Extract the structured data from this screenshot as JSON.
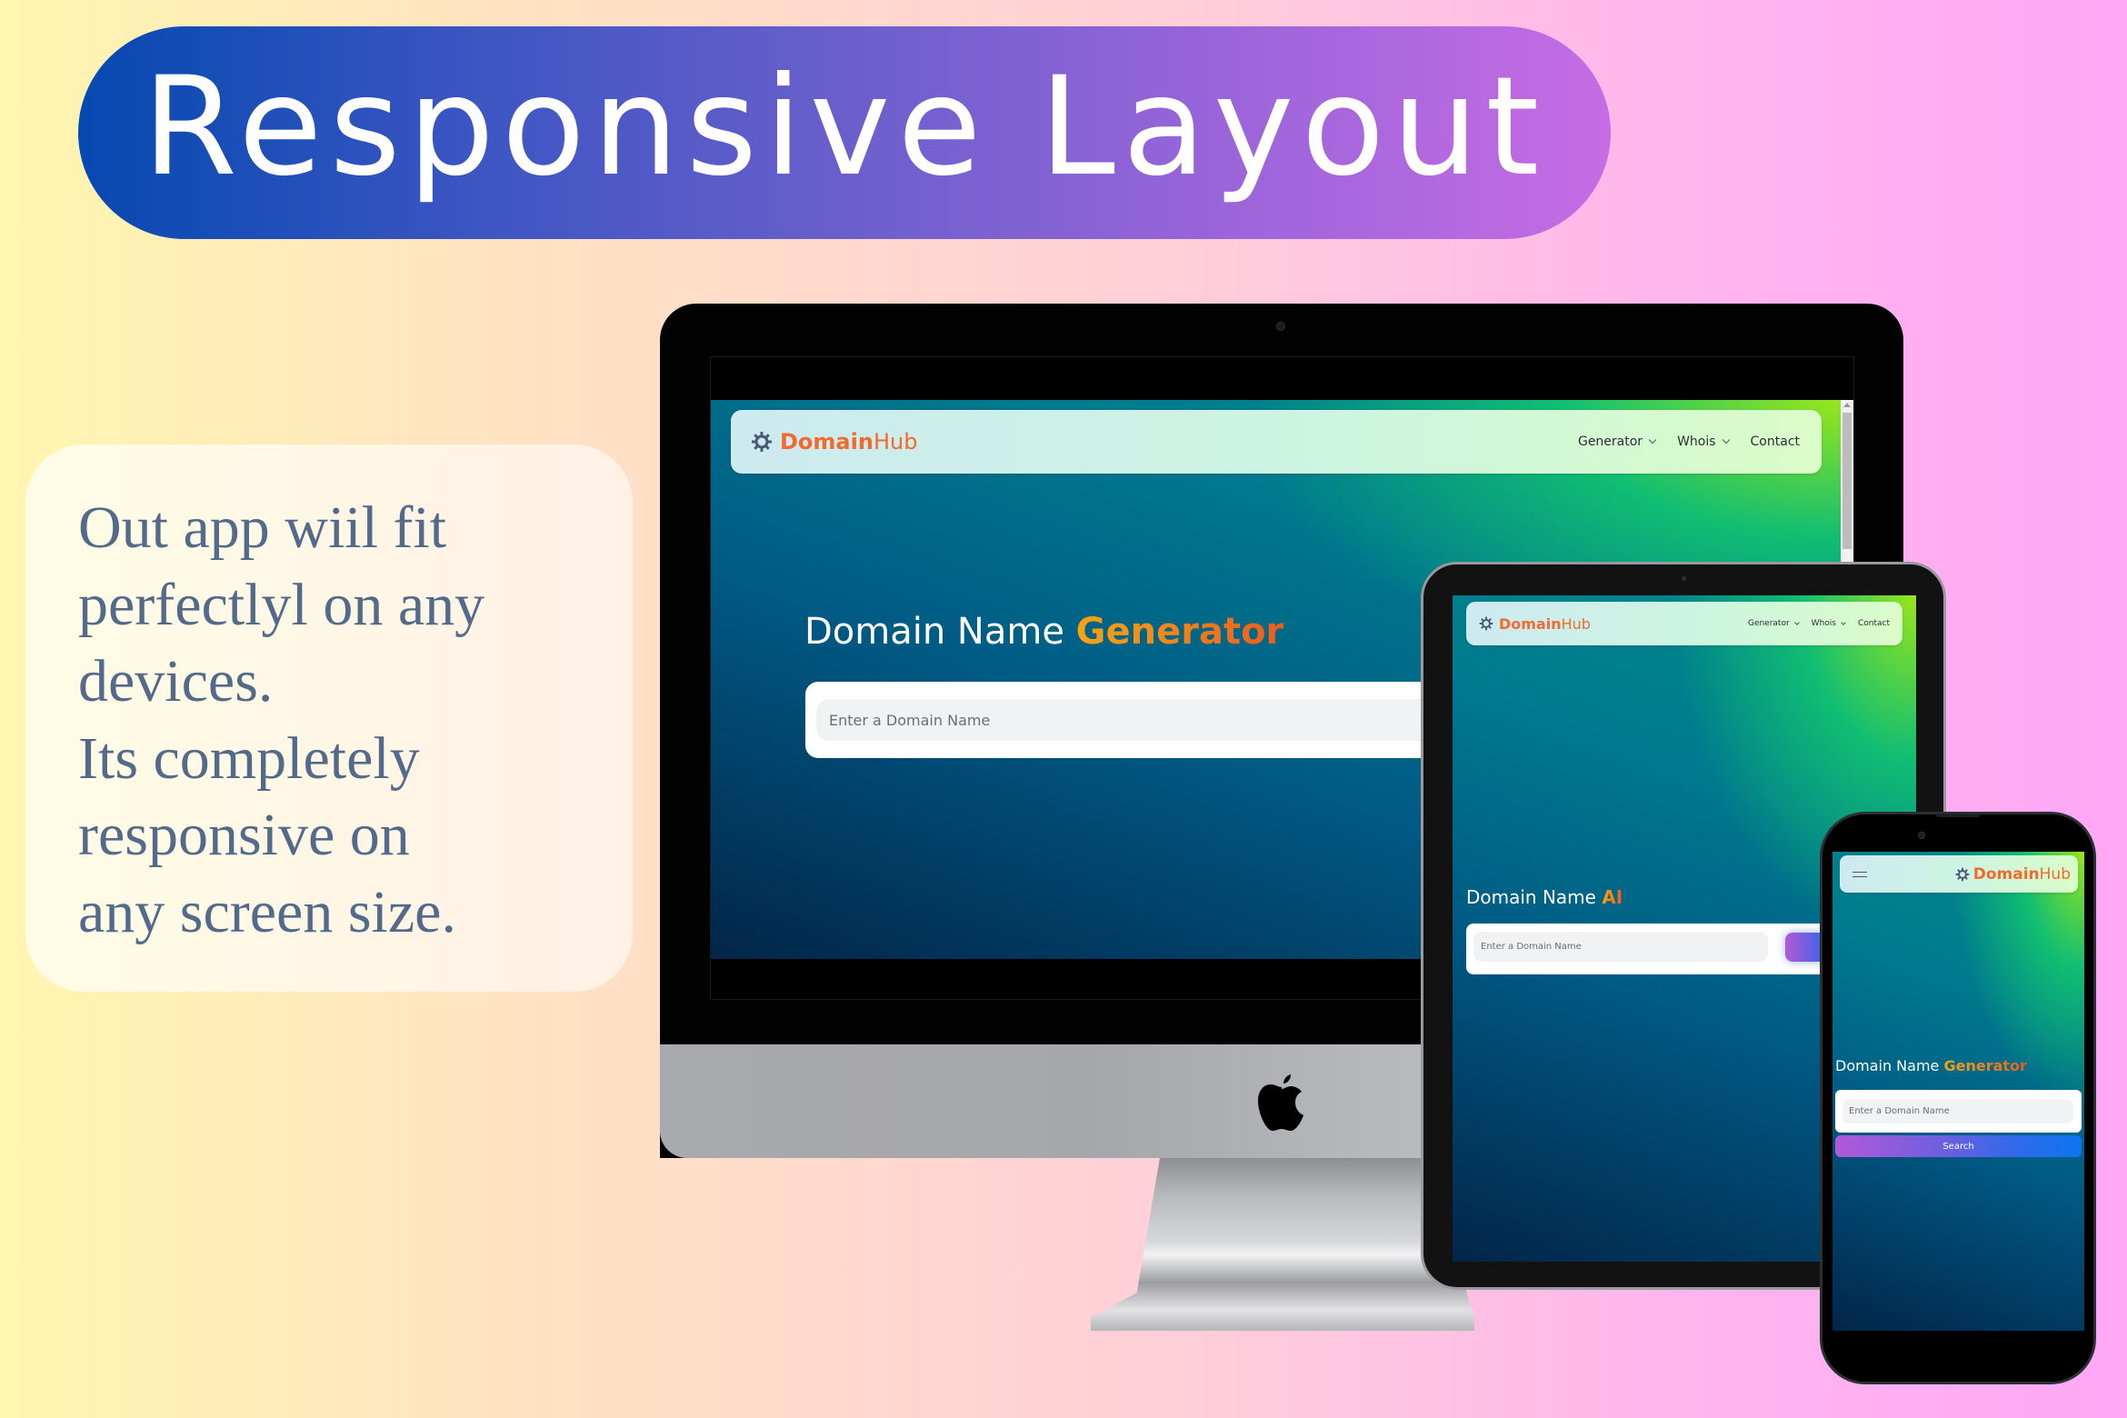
{
  "banner": {
    "title": "Responsive Layout"
  },
  "info_card": {
    "text": "Out app wiil fit\nperfectlyl on any\ndevices.\nIts completely\nresponsive on\nany screen size."
  },
  "brand": {
    "name_bold": "Domain",
    "name_regular": "Hub",
    "icon": "gear-icon",
    "color": "#f26a2e"
  },
  "nav": {
    "items": [
      {
        "label": "Generator",
        "has_dropdown": true
      },
      {
        "label": "Whois",
        "has_dropdown": true
      },
      {
        "label": "Contact",
        "has_dropdown": false
      }
    ]
  },
  "desktop": {
    "hero_prefix": "Domain Name ",
    "hero_accent": "Generator",
    "search_placeholder": "Enter a Domain Name"
  },
  "tablet": {
    "hero_prefix": "Domain Name ",
    "hero_accent": "AI",
    "search_placeholder": "Enter a Domain Name"
  },
  "phone": {
    "menu_icon": "hamburger-icon",
    "hero_prefix": "Domain Name ",
    "hero_accent": "Generator",
    "search_placeholder": "Enter a Domain Name",
    "search_button": "Search"
  },
  "colors": {
    "accent_orange": "#f5a312",
    "accent_red_orange": "#ee5a1f",
    "button_purple": "#b25ad8",
    "button_blue": "#0f74f0",
    "text_slate": "#546a8a"
  }
}
